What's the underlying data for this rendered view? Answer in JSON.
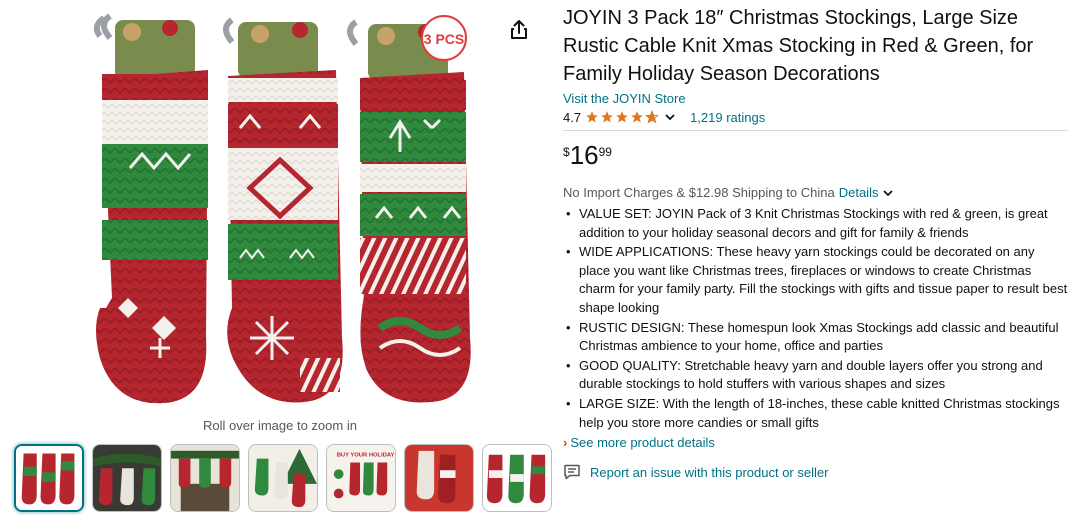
{
  "product": {
    "title": "JOYIN 3 Pack 18″ Christmas Stockings, Large Size Rustic Cable Knit Xmas Stocking in Red & Green, for Family Holiday Season Decorations",
    "store_link": "Visit the JOYIN Store",
    "rating_value": "4.7",
    "rating_fill": 0.7,
    "ratings_count": "1,219 ratings",
    "price": {
      "symbol": "$",
      "whole": "16",
      "fraction": "99"
    },
    "shipping_text": "No Import Charges & $12.98 Shipping to China",
    "shipping_details_link": "Details",
    "bullets": [
      "VALUE SET: JOYIN Pack of 3 Knit Christmas Stockings with red & green, is great addition to your holiday seasonal decors and gift for family & friends",
      "WIDE APPLICATIONS: These heavy yarn stockings could be decorated on any place you want like Christmas trees, fireplaces or windows to create Christmas charm for your family party. Fill the stockings with gifts and tissue paper to result best shape looking",
      "RUSTIC DESIGN: These homespun look Xmas Stockings add classic and beautiful Christmas ambience to your home, office and parties",
      "GOOD QUALITY: Stretchable heavy yarn and double layers offer you strong and durable stockings to hold stuffers with various shapes and sizes",
      "LARGE SIZE: With the length of 18-inches, these cable knitted Christmas stockings help you store more candies or small gifts"
    ],
    "see_more": "See more product details",
    "report_issue": "Report an issue with this product or seller"
  },
  "gallery": {
    "zoom_hint": "Roll over image to zoom in",
    "badge_text": "3 PCS",
    "thumb4_text": "BUY YOUR HOLIDAY",
    "thumbnails": [
      "stockings-trio",
      "mantel-scene",
      "fireplace-scene",
      "tree-scene",
      "holiday-promo",
      "red-background",
      "stockings-trio-alt"
    ],
    "selected_index": 0
  },
  "colors": {
    "link": "#007185",
    "accent_orange": "#c45500",
    "star": "#de7921",
    "stocking_red": "#b5262e",
    "stocking_green": "#2f8a3e"
  },
  "icons": [
    "share-icon",
    "star-icon",
    "chevron-down-icon",
    "chevron-right-icon",
    "report-icon"
  ]
}
